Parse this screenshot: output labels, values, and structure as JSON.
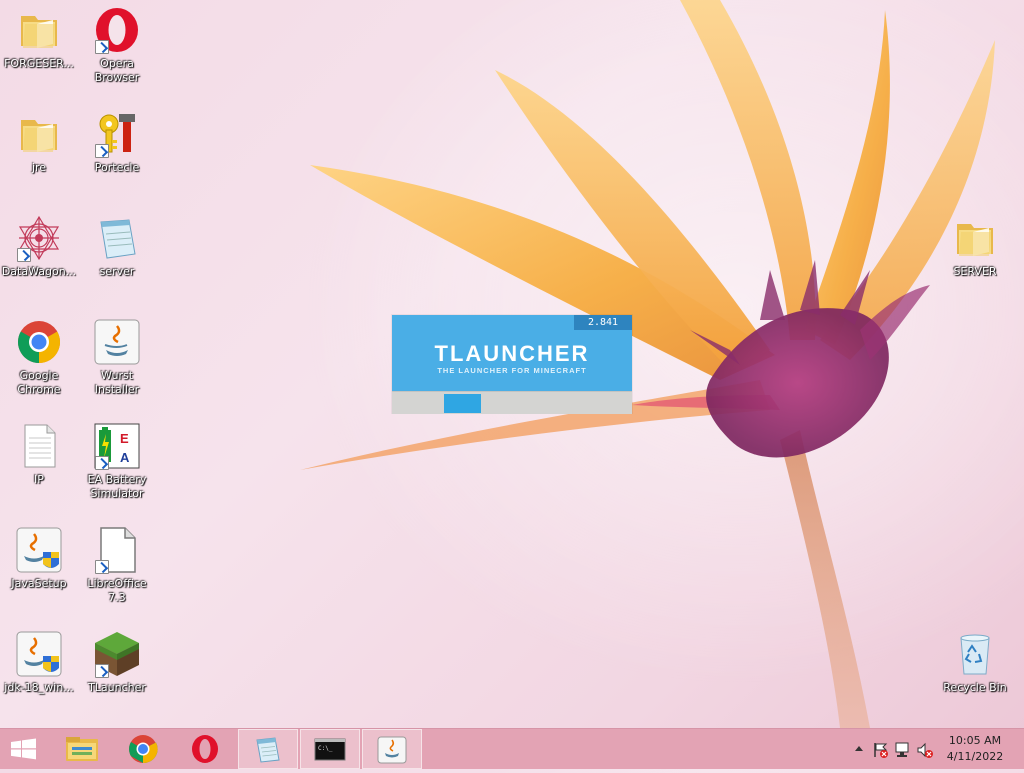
{
  "desktop": {
    "icons": [
      {
        "id": "forgeserver",
        "label": "FORGESER...",
        "type": "folder"
      },
      {
        "id": "opera",
        "label": "Opera Browser",
        "type": "opera"
      },
      {
        "id": "jre",
        "label": "jre",
        "type": "folder"
      },
      {
        "id": "portecle",
        "label": "Portecle",
        "type": "portecle"
      },
      {
        "id": "datawagon",
        "label": "DataWagon...",
        "type": "datawagon"
      },
      {
        "id": "server-notepad",
        "label": "server",
        "type": "notepad"
      },
      {
        "id": "chrome",
        "label": "Google Chrome",
        "type": "chrome"
      },
      {
        "id": "wurst",
        "label": "Wurst Installer",
        "type": "java"
      },
      {
        "id": "ip",
        "label": "IP",
        "type": "textfile"
      },
      {
        "id": "eabattery",
        "label": "EA Battery Simulator",
        "type": "eabattery"
      },
      {
        "id": "javasetup",
        "label": "JavaSetup",
        "type": "javasetup"
      },
      {
        "id": "libreoffice",
        "label": "LibreOffice 7.3",
        "type": "libreoffice"
      },
      {
        "id": "jdk18",
        "label": "jdk-18_win...",
        "type": "javasetup"
      },
      {
        "id": "tlauncher",
        "label": "TLauncher",
        "type": "grassblock"
      },
      {
        "id": "server-folder",
        "label": "SERVER",
        "type": "folder"
      },
      {
        "id": "recyclebin",
        "label": "Recycle Bin",
        "type": "recyclebin"
      }
    ]
  },
  "splash": {
    "version": "2.841",
    "title": "TLAUNCHER",
    "subtitle": "THE LAUNCHER FOR MINECRAFT"
  },
  "taskbar": {
    "buttons": [
      "windows-start",
      "file-explorer",
      "chrome",
      "opera",
      "notepad",
      "command-prompt",
      "java"
    ],
    "active": [
      "notepad",
      "command-prompt",
      "java"
    ]
  },
  "tray": {
    "time": "10:05 AM",
    "date": "4/11/2022",
    "icons": [
      "show-hidden-icon",
      "action-center-flag-icon",
      "network-icon",
      "volume-muted-icon"
    ]
  },
  "colors": {
    "taskbar": "#e3a3b4",
    "tlauncher_blue": "#4aaee6",
    "tlauncher_progress": "#2fa6e3"
  }
}
